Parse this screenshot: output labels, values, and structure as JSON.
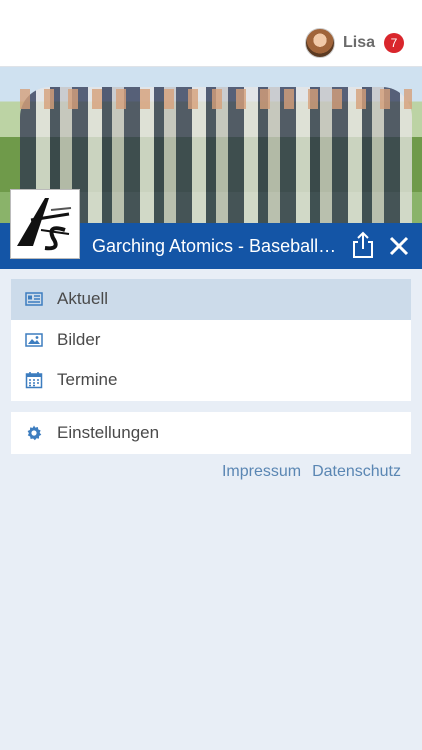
{
  "user": {
    "name": "Lisa",
    "notifications": "7"
  },
  "team": {
    "title": "Garching Atomics - Baseball i...",
    "logo_text": "AS"
  },
  "menu": {
    "items": [
      {
        "label": "Aktuell",
        "icon": "newspaper-icon",
        "active": true
      },
      {
        "label": "Bilder",
        "icon": "image-icon"
      },
      {
        "label": "Termine",
        "icon": "calendar-icon"
      }
    ],
    "settings": {
      "label": "Einstellungen",
      "icon": "gear-icon"
    }
  },
  "footer": {
    "impressum": "Impressum",
    "datenschutz": "Datenschutz"
  },
  "colors": {
    "primary": "#1455a6",
    "icon": "#3d7dbf",
    "active": "#ccdbea",
    "badge": "#d9262c",
    "link": "#5a86b3"
  }
}
